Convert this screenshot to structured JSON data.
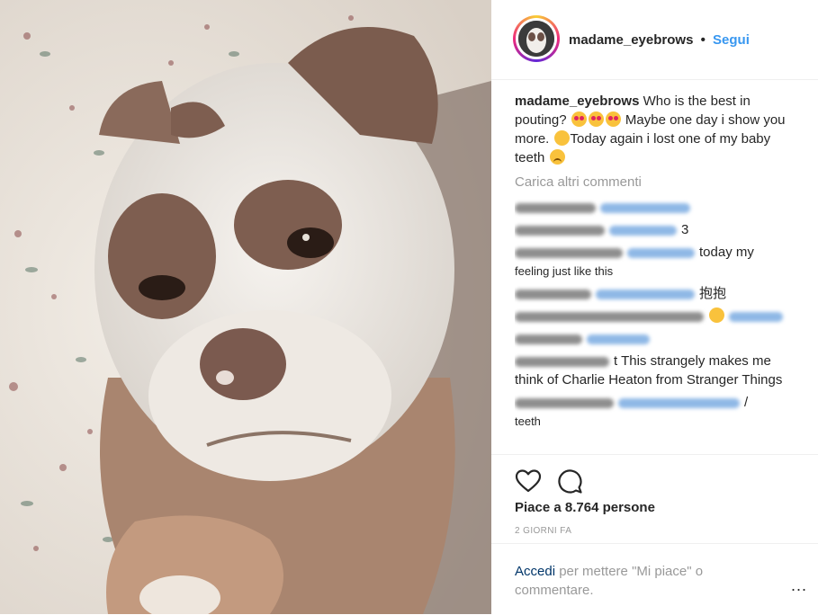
{
  "post": {
    "username": "madame_eyebrows",
    "follow_label": "Segui",
    "dot": "•",
    "caption_user": "madame_eyebrows",
    "caption_part1": " Who is the best in pouting? ",
    "caption_part2": " Maybe one day i show you more. ",
    "caption_part3": "Today again i lost one of my baby teeth ",
    "load_more": "Carica altri commenti",
    "comments": [
      {
        "text": ""
      },
      {
        "text": "3"
      },
      {
        "text": "today my"
      },
      {
        "text": "feeling just like this"
      },
      {
        "text": "抱抱"
      },
      {
        "text": ""
      },
      {
        "text": ""
      },
      {
        "text": "t This strangely makes me think of Charlie Heaton from Stranger Things"
      },
      {
        "text": "/"
      },
      {
        "text": "teeth"
      }
    ],
    "likes": "Piace a 8.764 persone",
    "time_ago": "2 GIORNI FA",
    "login_link": "Accedi",
    "login_rest": " per mettere \"Mi piace\" o commentare.",
    "more_label": "..."
  },
  "icons": {
    "like": "heart-outline-icon",
    "comment": "comment-bubble-icon",
    "more": "ellipsis-icon"
  },
  "colors": {
    "link_blue": "#3897f0",
    "login_blue": "#003569",
    "muted": "#999999",
    "text": "#262626"
  }
}
